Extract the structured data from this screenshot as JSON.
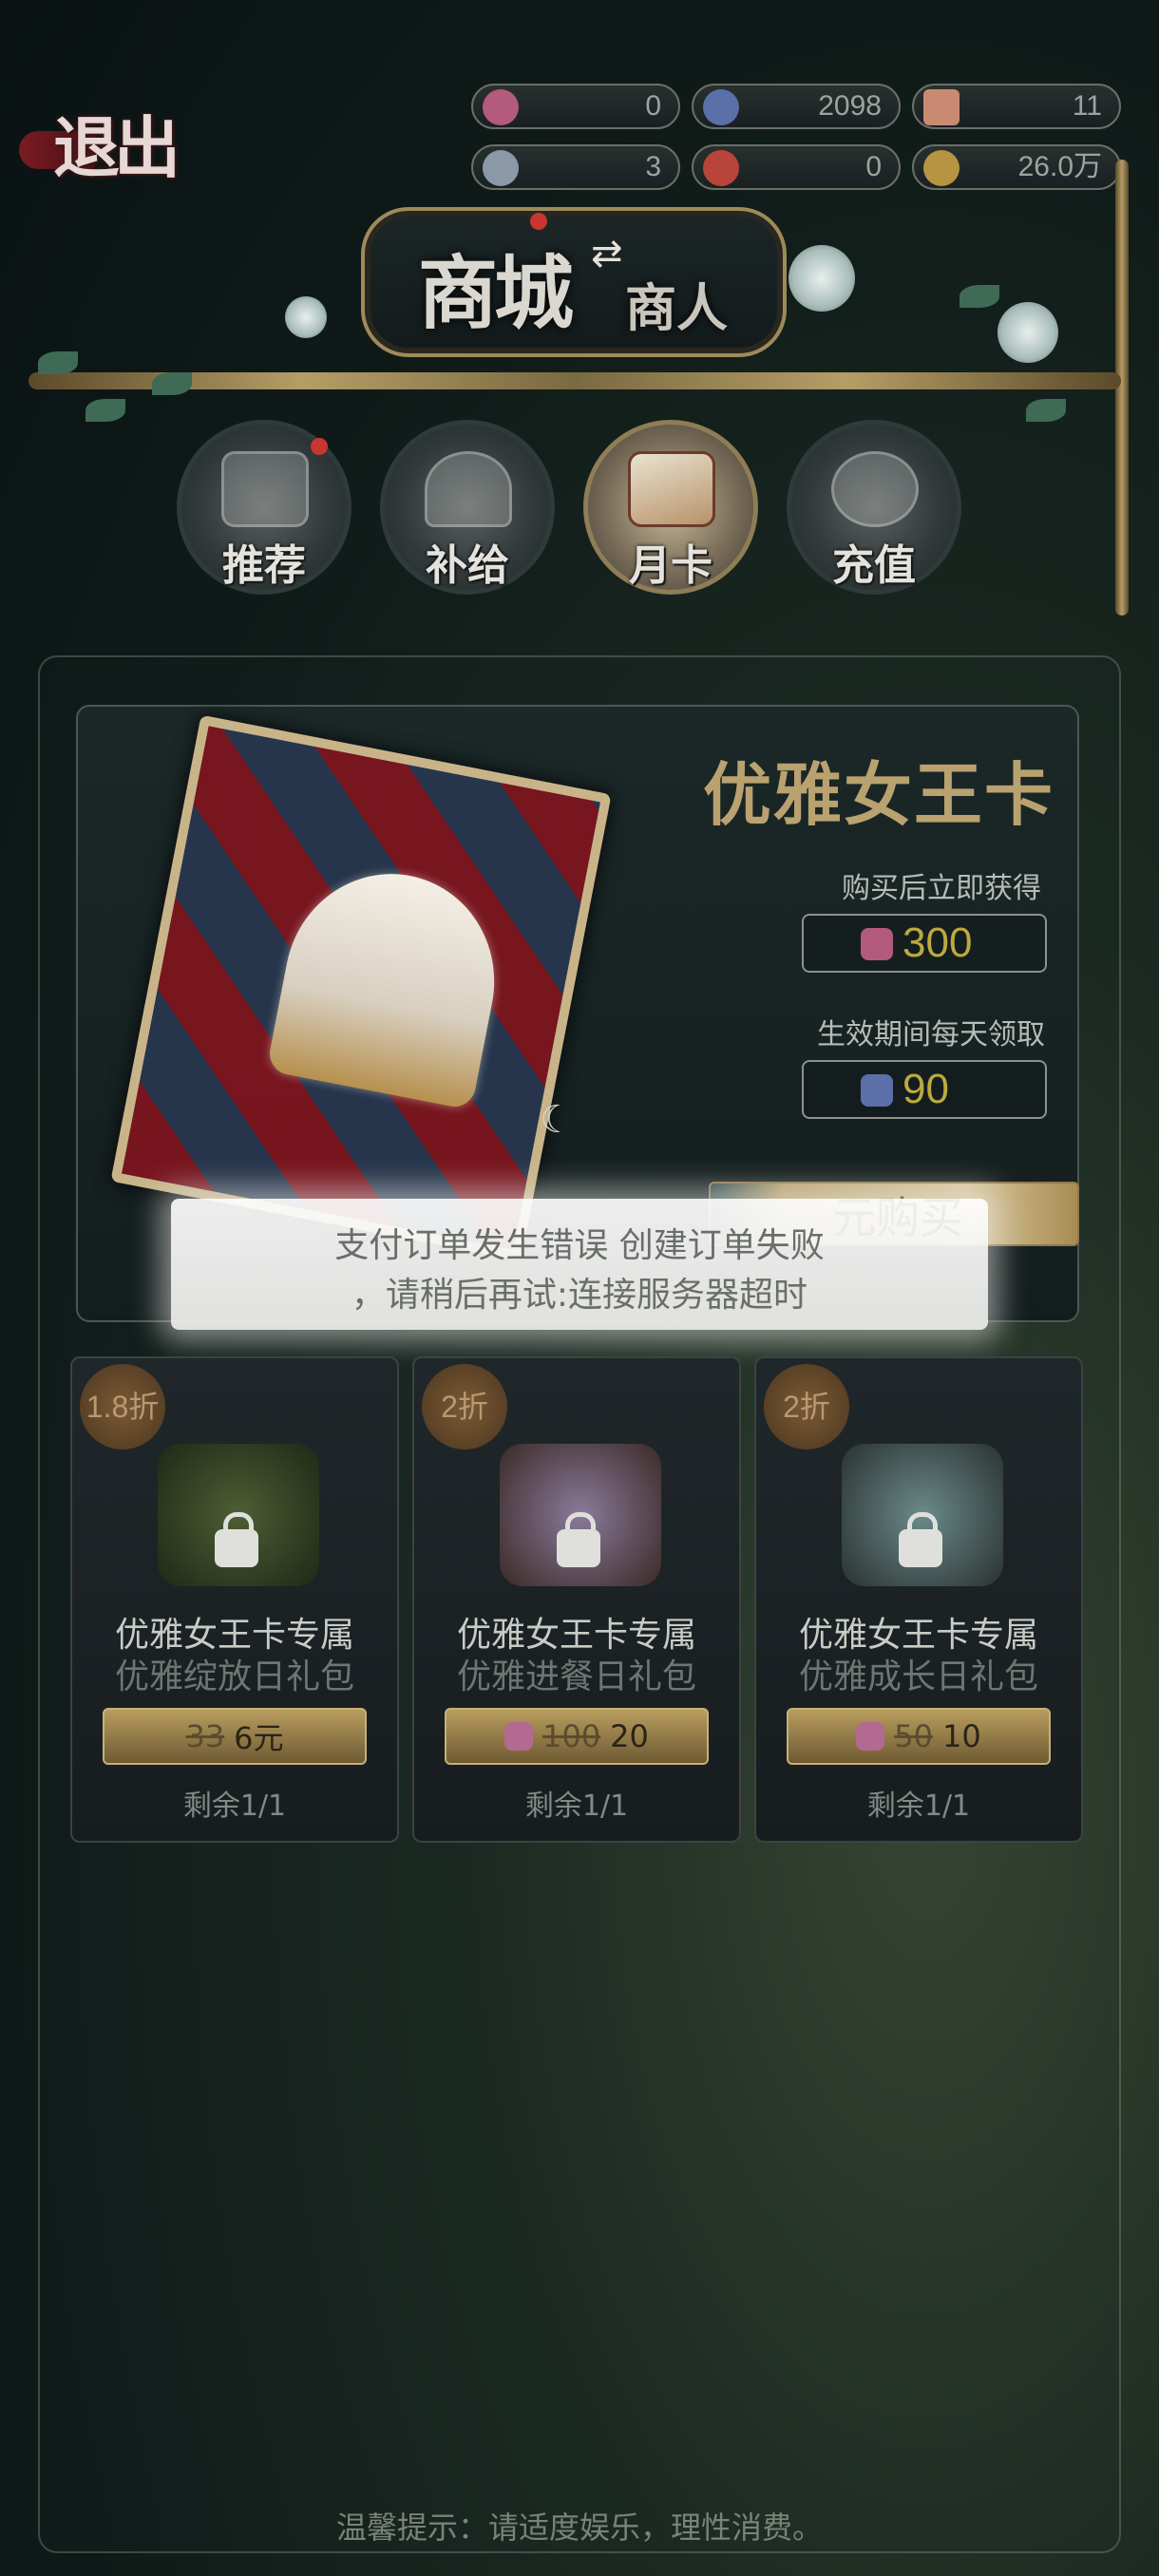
{
  "top": {
    "exit_label": "退出",
    "currencies": [
      {
        "icon": "pink-gem-icon",
        "value": "0"
      },
      {
        "icon": "blue-crystal-icon",
        "value": "2098"
      },
      {
        "icon": "ticket-icon",
        "value": "11"
      },
      {
        "icon": "button-token-icon",
        "value": "3"
      },
      {
        "icon": "red-badge-icon",
        "value": "0"
      },
      {
        "icon": "gold-coins-icon",
        "value": "26.0万"
      }
    ]
  },
  "header": {
    "mall_title": "商城",
    "merchant_title": "商人",
    "swap_glyph": "⇄"
  },
  "tabs": [
    {
      "label": "推荐",
      "active": false,
      "has_dot": true
    },
    {
      "label": "补给",
      "active": false,
      "has_dot": false
    },
    {
      "label": "月卡",
      "active": true,
      "has_dot": false
    },
    {
      "label": "充值",
      "active": false,
      "has_dot": false
    }
  ],
  "card": {
    "title": "优雅女王卡",
    "instant_label": "购买后立即获得",
    "instant_value": "300",
    "daily_label": "生效期间每天领取",
    "daily_value": "90",
    "buy_label": "元购买"
  },
  "toast": {
    "line1": "支付订单发生错误 创建订单失败",
    "line2": "，请稍后再试:连接服务器超时"
  },
  "packs": [
    {
      "badge": "1.8折",
      "name": "优雅女王卡专属",
      "sub": "优雅绽放日礼包",
      "old_price": "33",
      "new_price": "6元",
      "currency_icon": "",
      "remaining": "剩余1/1",
      "img_color": "#3c4a2c"
    },
    {
      "badge": "2折",
      "name": "优雅女王卡专属",
      "sub": "优雅进餐日礼包",
      "old_price": "100",
      "new_price": "20",
      "currency_icon": "pink-gem-icon",
      "remaining": "剩余1/1",
      "img_color": "#6a4e4a"
    },
    {
      "badge": "2折",
      "name": "优雅女王卡专属",
      "sub": "优雅成长日礼包",
      "old_price": "50",
      "new_price": "10",
      "currency_icon": "pink-gem-icon",
      "remaining": "剩余1/1",
      "img_color": "#4a5a58"
    }
  ],
  "footer": {
    "tip": "温馨提示：请适度娱乐，理性消费。"
  }
}
